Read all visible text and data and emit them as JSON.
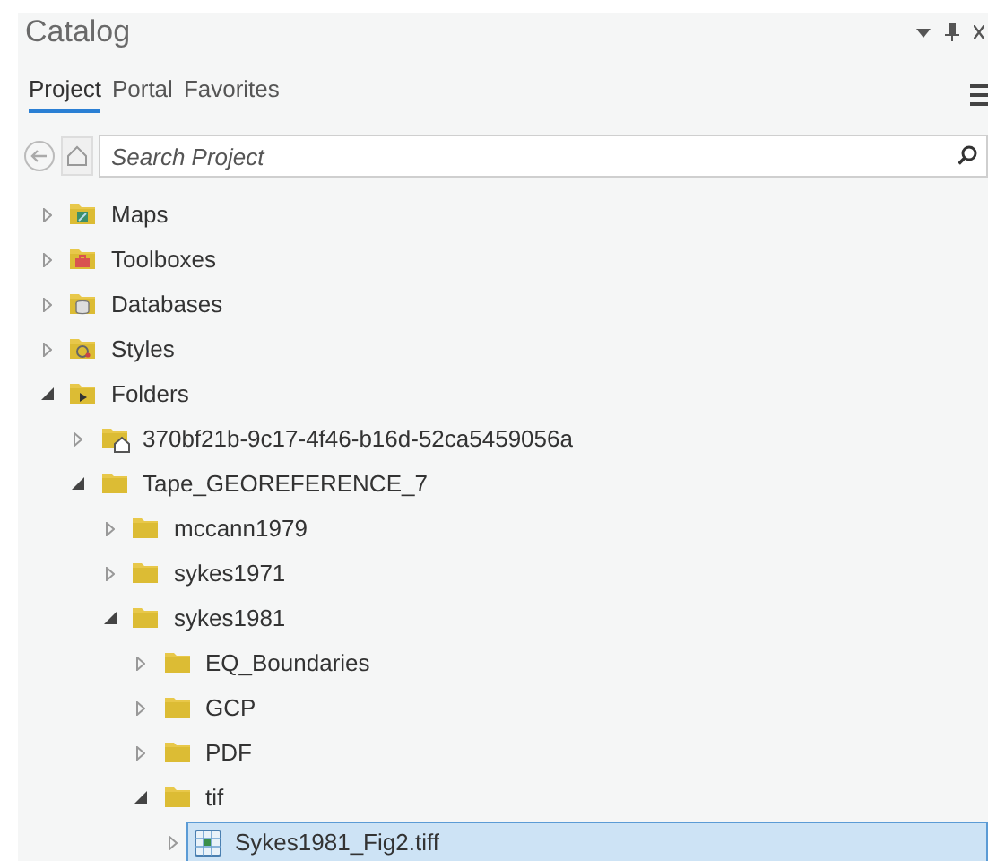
{
  "pane": {
    "title": "Catalog"
  },
  "tabs": [
    {
      "label": "Project",
      "selected": true
    },
    {
      "label": "Portal",
      "selected": false
    },
    {
      "label": "Favorites",
      "selected": false
    }
  ],
  "search": {
    "placeholder": "Search Project"
  },
  "tree": [
    {
      "label": "Maps",
      "kind": "maps",
      "expanded": false,
      "selected": false
    },
    {
      "label": "Toolboxes",
      "kind": "toolboxes",
      "expanded": false,
      "selected": false
    },
    {
      "label": "Databases",
      "kind": "databases",
      "expanded": false,
      "selected": false
    },
    {
      "label": "Styles",
      "kind": "styles",
      "expanded": false,
      "selected": false
    },
    {
      "label": "Folders",
      "kind": "folders",
      "expanded": true,
      "selected": false,
      "children": [
        {
          "label": "370bf21b-9c17-4f46-b16d-52ca5459056a",
          "kind": "home-folder",
          "expanded": false,
          "selected": false
        },
        {
          "label": "Tape_GEOREFERENCE_7",
          "kind": "folder",
          "expanded": true,
          "selected": false,
          "children": [
            {
              "label": "mccann1979",
              "kind": "folder",
              "expanded": false,
              "selected": false
            },
            {
              "label": "sykes1971",
              "kind": "folder",
              "expanded": false,
              "selected": false
            },
            {
              "label": "sykes1981",
              "kind": "folder",
              "expanded": true,
              "selected": false,
              "children": [
                {
                  "label": "EQ_Boundaries",
                  "kind": "folder",
                  "expanded": false,
                  "selected": false
                },
                {
                  "label": "GCP",
                  "kind": "folder",
                  "expanded": false,
                  "selected": false
                },
                {
                  "label": "PDF",
                  "kind": "folder",
                  "expanded": false,
                  "selected": false
                },
                {
                  "label": "tif",
                  "kind": "folder",
                  "expanded": true,
                  "selected": false,
                  "children": [
                    {
                      "label": "Sykes1981_Fig2.tiff",
                      "kind": "raster",
                      "expanded": false,
                      "selected": true
                    }
                  ]
                }
              ]
            }
          ]
        }
      ]
    }
  ]
}
